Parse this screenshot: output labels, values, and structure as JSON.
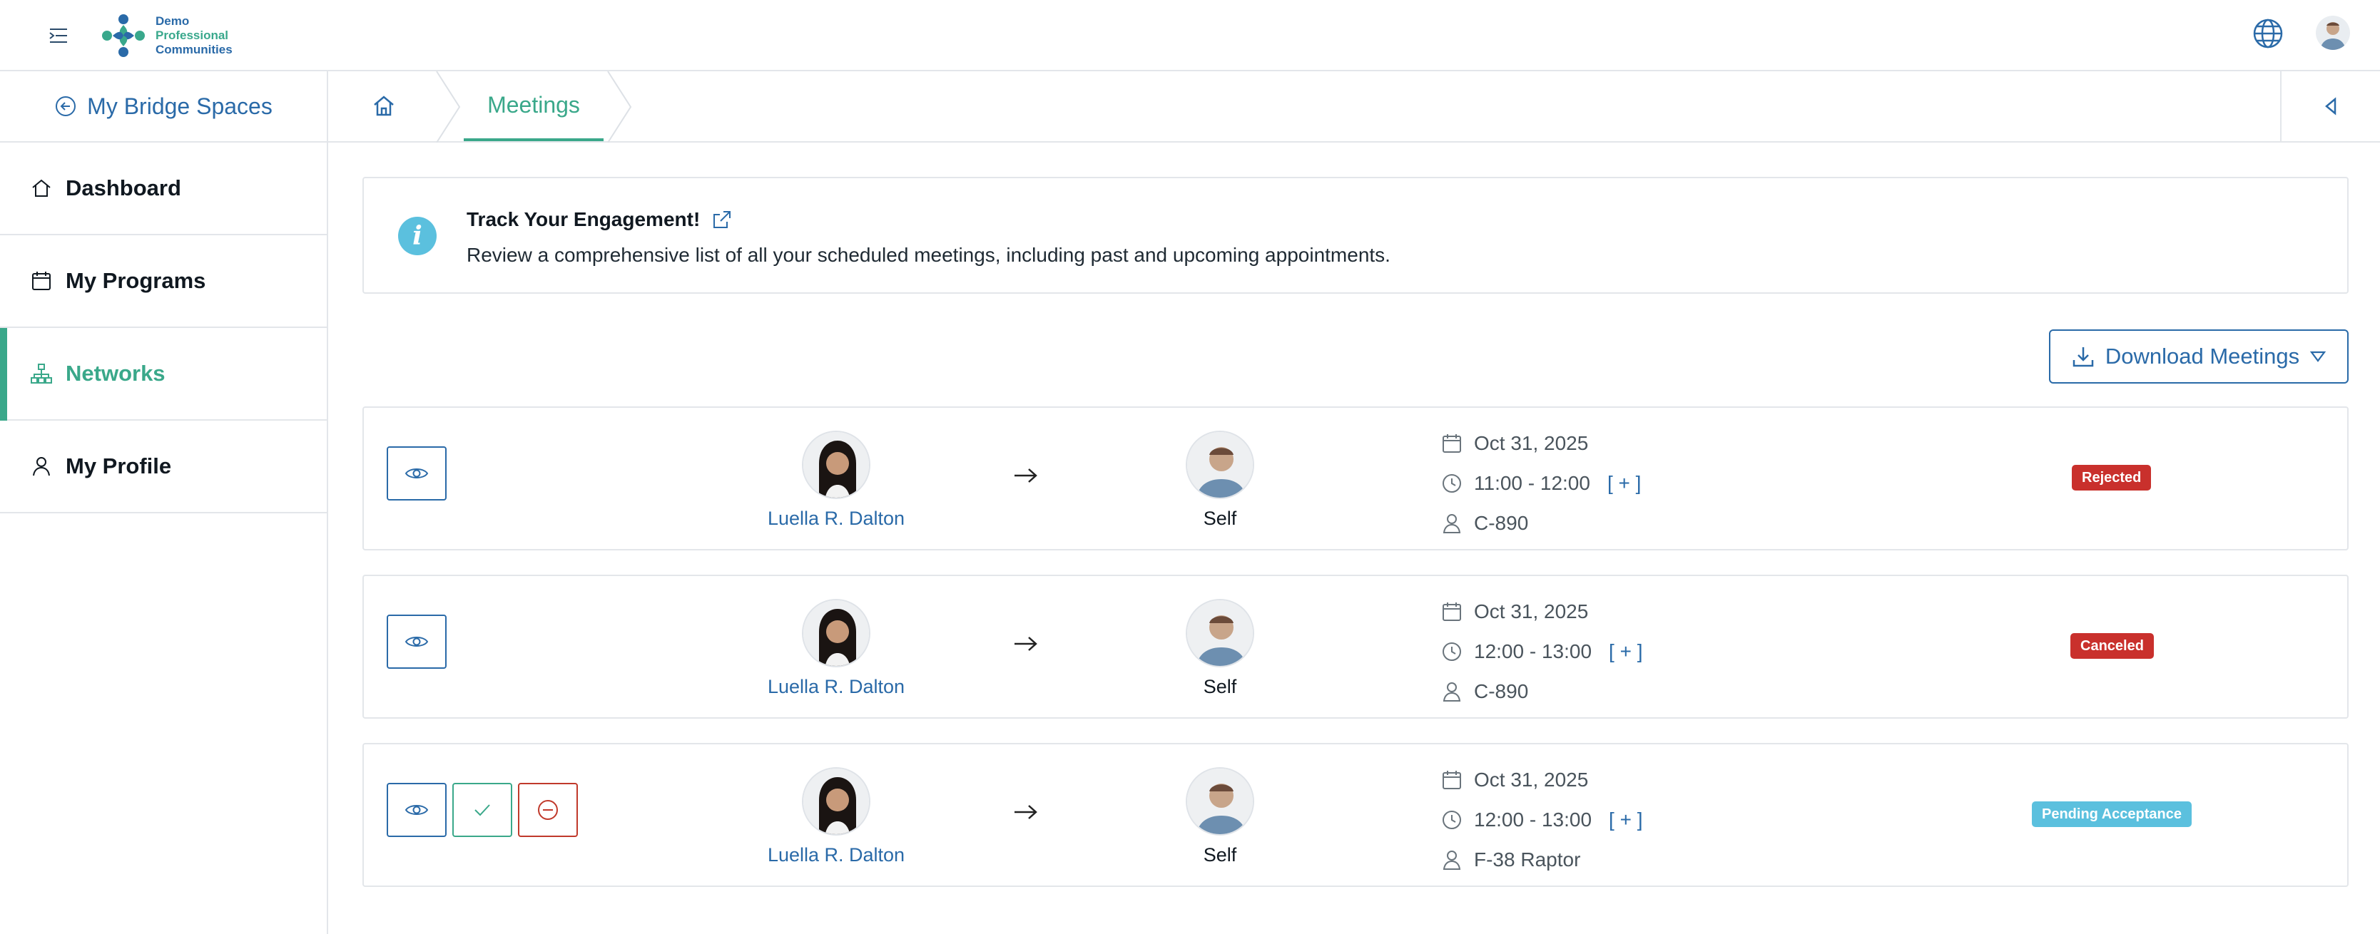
{
  "brand": {
    "line1": "Demo",
    "line2": "Professional",
    "line3": "Communities"
  },
  "sidebar": {
    "back_label": "My Bridge Spaces",
    "items": [
      {
        "label": "Dashboard",
        "icon": "home-icon",
        "active": false
      },
      {
        "label": "My Programs",
        "icon": "calendar-icon",
        "active": false
      },
      {
        "label": "Networks",
        "icon": "network-icon",
        "active": true
      },
      {
        "label": "My Profile",
        "icon": "user-icon",
        "active": false
      }
    ]
  },
  "breadcrumb": {
    "current": "Meetings"
  },
  "info": {
    "title": "Track Your Engagement!",
    "text": "Review a comprehensive list of all your scheduled meetings, including past and upcoming appointments."
  },
  "download_label": "Download Meetings",
  "meetings": [
    {
      "from": "Luella R. Dalton",
      "to": "Self",
      "date": "Oct 31, 2025",
      "time": "11:00 - 12:00",
      "more": "[ + ]",
      "location": "C-890",
      "status": "Rejected",
      "status_color": "#c9302c"
    },
    {
      "from": "Luella R. Dalton",
      "to": "Self",
      "date": "Oct 31, 2025",
      "time": "12:00 - 13:00",
      "more": "[ + ]",
      "location": "C-890",
      "status": "Canceled",
      "status_color": "#c9302c"
    },
    {
      "from": "Luella R. Dalton",
      "to": "Self",
      "date": "Oct 31, 2025",
      "time": "12:00 - 13:00",
      "more": "[ + ]",
      "location": "F-38 Raptor",
      "status": "Pending Acceptance",
      "status_color": "#5bc0de"
    }
  ],
  "colors": {
    "primary": "#2a6aa8",
    "accent": "#3aa88a",
    "danger": "#c9302c",
    "info": "#5bc0de"
  }
}
